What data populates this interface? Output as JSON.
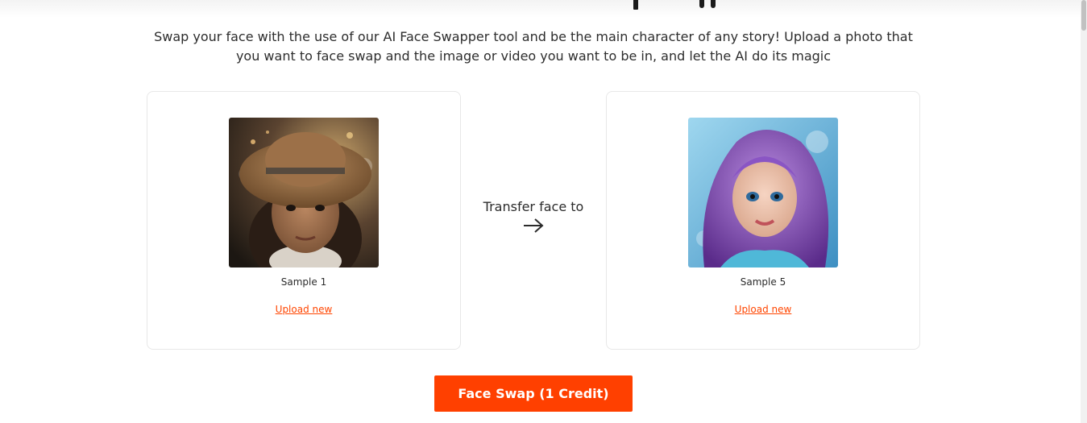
{
  "description": "Swap your face with the use of our AI Face Swapper tool and be the main character of any story! Upload a photo that you want to face swap and the image or video you want to be in, and let the AI do its magic",
  "source_card": {
    "image_icon": "girl-hat-photo-icon",
    "label": "Sample 1",
    "upload_label": "Upload new"
  },
  "transfer": {
    "label": "Transfer face to",
    "icon": "arrow-right-icon"
  },
  "target_card": {
    "image_icon": "purple-hair-mermaid-photo-icon",
    "label": "Sample 5",
    "upload_label": "Upload new"
  },
  "swap_button": {
    "label": "Face Swap (1 Credit)"
  },
  "colors": {
    "accent": "#ff4000",
    "link": "#ff4500",
    "text": "#2b2b2b",
    "card_border": "#e8e8e8"
  }
}
